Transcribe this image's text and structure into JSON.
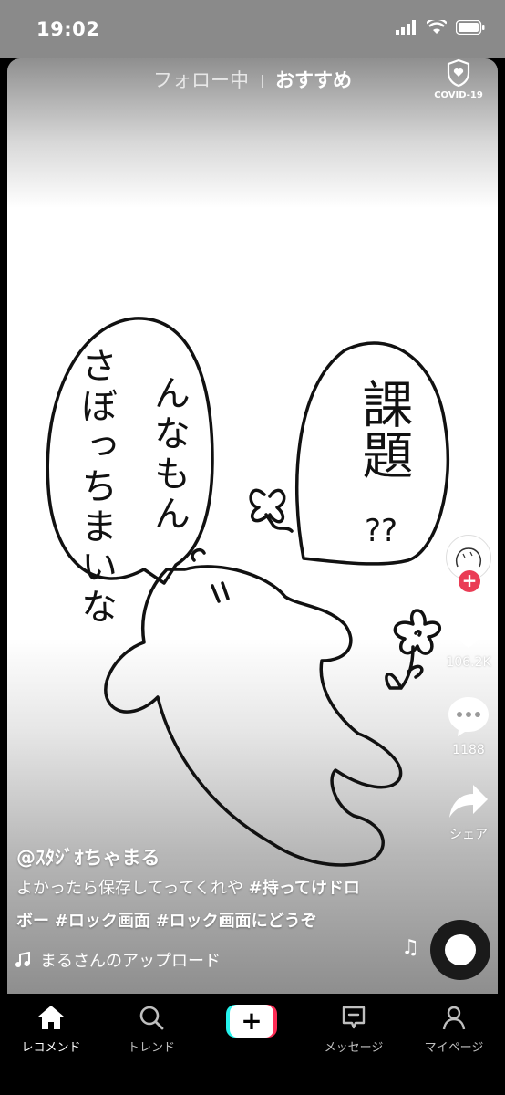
{
  "status": {
    "time": "19:02"
  },
  "top_tabs": {
    "following": "フォロー中",
    "recommended": "おすすめ",
    "covid_label": "COVID-19"
  },
  "video": {
    "speech_left": [
      "さぼっちまいな",
      "んなもん"
    ],
    "speech_right": [
      "課題",
      "??"
    ]
  },
  "side": {
    "likes": "106.2K",
    "comments": "1188",
    "share": "シェア"
  },
  "caption": {
    "author": "@ｽﾀｼﾞｵちゃまる",
    "text_plain": "よかったら保存してってくれや ",
    "tag1": "#持ってけドロボー",
    "tag2": "#ロック画面",
    "tag3": "#ロック画面にどうぞ",
    "line1_tag": "#持ってけドロ",
    "line2_start": "ボー"
  },
  "music": {
    "title": "まるさんのアップロード"
  },
  "nav": {
    "home": "レコメンド",
    "trend": "トレンド",
    "create": "+",
    "messages": "メッセージ",
    "me": "マイページ"
  }
}
